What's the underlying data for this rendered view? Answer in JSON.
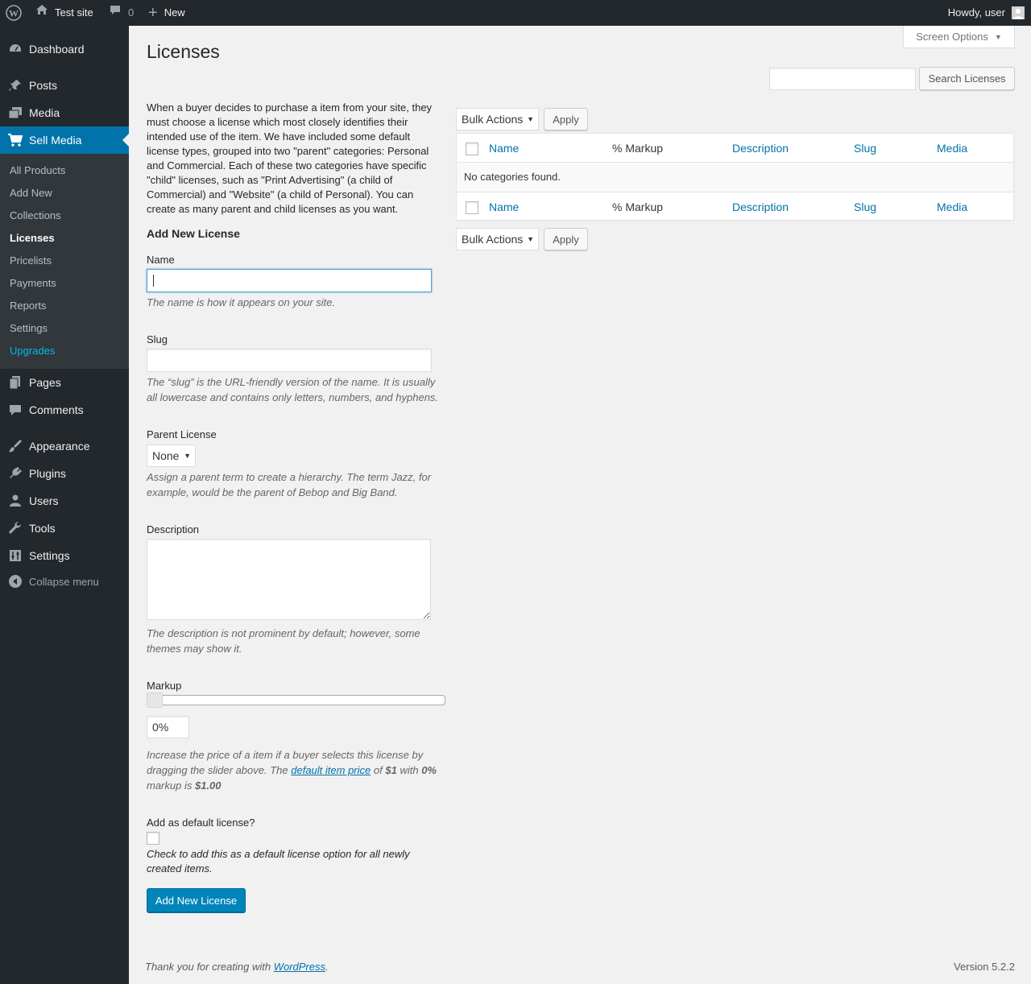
{
  "adminbar": {
    "site_name": "Test site",
    "comments_count": "0",
    "new_label": "New",
    "howdy": "Howdy, user"
  },
  "sidebar": {
    "top_items": [
      {
        "label": "Dashboard",
        "icon": "dashboard-icon"
      },
      {
        "label": "Posts",
        "icon": "pushpin-icon"
      },
      {
        "label": "Media",
        "icon": "media-icon"
      },
      {
        "label": "Sell Media",
        "icon": "cart-icon"
      },
      {
        "label": "Pages",
        "icon": "pages-icon"
      },
      {
        "label": "Comments",
        "icon": "comment-icon"
      },
      {
        "label": "Appearance",
        "icon": "brush-icon"
      },
      {
        "label": "Plugins",
        "icon": "plugin-icon"
      },
      {
        "label": "Users",
        "icon": "user-icon"
      },
      {
        "label": "Tools",
        "icon": "wrench-icon"
      },
      {
        "label": "Settings",
        "icon": "settings-icon"
      }
    ],
    "sub_items": [
      "All Products",
      "Add New",
      "Collections",
      "Licenses",
      "Pricelists",
      "Payments",
      "Reports",
      "Settings",
      "Upgrades"
    ],
    "collapse": "Collapse menu"
  },
  "header": {
    "title": "Licenses",
    "screen_options": "Screen Options"
  },
  "search": {
    "value": "",
    "button": "Search Licenses"
  },
  "intro": "When a buyer decides to purchase a item from your site, they must choose a license which most closely identifies their intended use of the item. We have included some default license types, grouped into two \"parent\" categories: Personal and Commercial. Each of these two categories have specific \"child\" licenses, such as \"Print Advertising\" (a child of Commercial) and \"Website\" (a child of Personal). You can create as many parent and child licenses as you want.",
  "form": {
    "heading": "Add New License",
    "name_label": "Name",
    "name_value": "",
    "name_desc": "The name is how it appears on your site.",
    "slug_label": "Slug",
    "slug_value": "",
    "slug_desc": "The “slug” is the URL-friendly version of the name. It is usually all lowercase and contains only letters, numbers, and hyphens.",
    "parent_label": "Parent License",
    "parent_value": "None",
    "parent_desc": "Assign a parent term to create a hierarchy. The term Jazz, for example, would be the parent of Bebop and Big Band.",
    "description_label": "Description",
    "description_value": "",
    "description_desc": "The description is not prominent by default; however, some themes may show it.",
    "markup_label": "Markup",
    "markup_value": "0%",
    "markup_fraction": 0,
    "markup_desc_1": "Increase the price of a item if a buyer selects this license by dragging the slider above. The",
    "markup_link": "default item price",
    "markup_desc_2": "of",
    "markup_price": "$1",
    "markup_desc_3": "with",
    "markup_pct": "0%",
    "markup_desc_4": "markup is",
    "markup_total": "$1.00",
    "default_label": "Add as default license?",
    "default_checked": false,
    "default_desc": "Check to add this as a default license option for all newly created items.",
    "submit": "Add New License"
  },
  "table": {
    "bulk_actions": "Bulk Actions",
    "apply": "Apply",
    "columns": [
      "Name",
      "% Markup",
      "Description",
      "Slug",
      "Media"
    ],
    "empty": "No categories found."
  },
  "footer": {
    "thanks_prefix": "Thank you for creating with",
    "thanks_link": "WordPress",
    "thanks_suffix": ".",
    "version": "Version 5.2.2"
  },
  "colors": {
    "adminbar_bg": "#23282d",
    "sidebar_bg": "#23282d",
    "submenu_bg": "#32373c",
    "accent": "#0073aa",
    "primary_button": "#0085ba"
  }
}
